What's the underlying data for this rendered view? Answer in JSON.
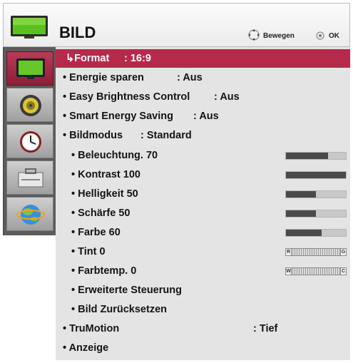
{
  "header": {
    "title": "BILD",
    "hint_move": "Bewegen",
    "hint_ok": "OK"
  },
  "sidebar": {
    "items": [
      {
        "icon": "tv-picture-icon",
        "active": true
      },
      {
        "icon": "speaker-audio-icon",
        "active": false
      },
      {
        "icon": "clock-time-icon",
        "active": false
      },
      {
        "icon": "toolbox-options-icon",
        "active": false
      },
      {
        "icon": "globe-network-icon",
        "active": false
      }
    ]
  },
  "menu": {
    "format": {
      "label": "Format",
      "value": ": 16:9"
    },
    "energie": {
      "label": "Energie sparen",
      "value": ": Aus"
    },
    "easy_brightness": {
      "label": "Easy Brightness Control",
      "value": ": Aus"
    },
    "smart_energy": {
      "label": "Smart Energy Saving",
      "value": ": Aus"
    },
    "bildmodus": {
      "label": "Bildmodus",
      "value": ": Standard"
    },
    "beleuchtung": {
      "label": "Beleuchtung. 70",
      "level": 0.7
    },
    "kontrast": {
      "label": "Kontrast 100",
      "level": 1.0
    },
    "helligkeit": {
      "label": "Helligkeit 50",
      "level": 0.5
    },
    "schaerfe": {
      "label": "Schärfe 50",
      "level": 0.5
    },
    "farbe": {
      "label": "Farbe 60",
      "level": 0.6
    },
    "tint": {
      "label": "Tint 0",
      "left_end": "R",
      "right_end": "G"
    },
    "farbtemp": {
      "label": "Farbtemp. 0",
      "left_end": "W",
      "right_end": "C"
    },
    "erweiterte": {
      "label": "Erweiterte Steuerung"
    },
    "zuruecksetzen": {
      "label": "Bild Zurücksetzen"
    },
    "trumotion": {
      "label": "TruMotion",
      "value": ": Tief"
    },
    "anzeige": {
      "label": "Anzeige"
    }
  },
  "colors": {
    "accent": "#b7294a",
    "panel": "#e4e4e4",
    "sidebar": "#5b5b5b"
  }
}
